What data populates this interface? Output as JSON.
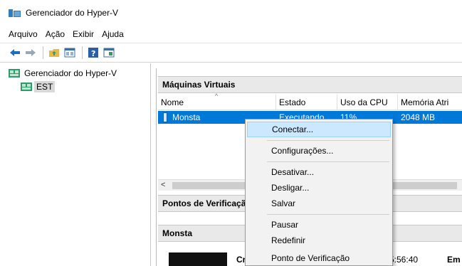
{
  "window": {
    "title": "Gerenciador do Hyper-V"
  },
  "menubar": {
    "items": [
      "Arquivo",
      "Ação",
      "Exibir",
      "Ajuda"
    ]
  },
  "toolbar": {
    "icons": [
      "back-arrow-icon",
      "forward-arrow-icon",
      "folder-up-icon",
      "show-tree-icon",
      "help-icon",
      "properties-icon"
    ]
  },
  "tree": {
    "root": "Gerenciador do Hyper-V",
    "server": "EST"
  },
  "vms_panel": {
    "title": "Máquinas Virtuais",
    "columns": [
      "Nome",
      "Estado",
      "Uso da CPU",
      "Memória Atri"
    ],
    "rows": [
      {
        "name": "Monsta",
        "state": "Executando",
        "cpu": "11%",
        "memory": "2048 MB"
      }
    ]
  },
  "checkpoints_panel": {
    "title": "Pontos de Verificação"
  },
  "details_panel": {
    "title": "Monsta",
    "created_label": "Cri",
    "time": "5:56:40",
    "right_label": "Em"
  },
  "context_menu": {
    "items": [
      "Conectar...",
      "Configurações...",
      "Desativar...",
      "Desligar...",
      "Salvar",
      "Pausar",
      "Redefinir",
      "Ponto de Verificação"
    ]
  },
  "colors": {
    "selection": "#0078d7",
    "menu_highlight": "#cce8ff",
    "hyperv_green": "#2d9b6a"
  }
}
